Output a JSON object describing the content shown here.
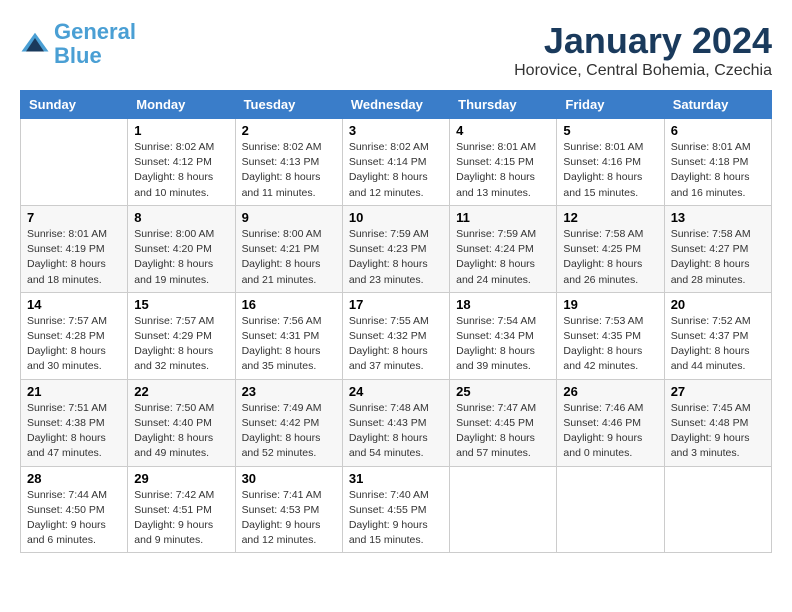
{
  "logo": {
    "line1": "General",
    "line2": "Blue"
  },
  "title": "January 2024",
  "location": "Horovice, Central Bohemia, Czechia",
  "days_of_week": [
    "Sunday",
    "Monday",
    "Tuesday",
    "Wednesday",
    "Thursday",
    "Friday",
    "Saturday"
  ],
  "weeks": [
    [
      {
        "day": "",
        "info": ""
      },
      {
        "day": "1",
        "info": "Sunrise: 8:02 AM\nSunset: 4:12 PM\nDaylight: 8 hours\nand 10 minutes."
      },
      {
        "day": "2",
        "info": "Sunrise: 8:02 AM\nSunset: 4:13 PM\nDaylight: 8 hours\nand 11 minutes."
      },
      {
        "day": "3",
        "info": "Sunrise: 8:02 AM\nSunset: 4:14 PM\nDaylight: 8 hours\nand 12 minutes."
      },
      {
        "day": "4",
        "info": "Sunrise: 8:01 AM\nSunset: 4:15 PM\nDaylight: 8 hours\nand 13 minutes."
      },
      {
        "day": "5",
        "info": "Sunrise: 8:01 AM\nSunset: 4:16 PM\nDaylight: 8 hours\nand 15 minutes."
      },
      {
        "day": "6",
        "info": "Sunrise: 8:01 AM\nSunset: 4:18 PM\nDaylight: 8 hours\nand 16 minutes."
      }
    ],
    [
      {
        "day": "7",
        "info": "Sunrise: 8:01 AM\nSunset: 4:19 PM\nDaylight: 8 hours\nand 18 minutes."
      },
      {
        "day": "8",
        "info": "Sunrise: 8:00 AM\nSunset: 4:20 PM\nDaylight: 8 hours\nand 19 minutes."
      },
      {
        "day": "9",
        "info": "Sunrise: 8:00 AM\nSunset: 4:21 PM\nDaylight: 8 hours\nand 21 minutes."
      },
      {
        "day": "10",
        "info": "Sunrise: 7:59 AM\nSunset: 4:23 PM\nDaylight: 8 hours\nand 23 minutes."
      },
      {
        "day": "11",
        "info": "Sunrise: 7:59 AM\nSunset: 4:24 PM\nDaylight: 8 hours\nand 24 minutes."
      },
      {
        "day": "12",
        "info": "Sunrise: 7:58 AM\nSunset: 4:25 PM\nDaylight: 8 hours\nand 26 minutes."
      },
      {
        "day": "13",
        "info": "Sunrise: 7:58 AM\nSunset: 4:27 PM\nDaylight: 8 hours\nand 28 minutes."
      }
    ],
    [
      {
        "day": "14",
        "info": "Sunrise: 7:57 AM\nSunset: 4:28 PM\nDaylight: 8 hours\nand 30 minutes."
      },
      {
        "day": "15",
        "info": "Sunrise: 7:57 AM\nSunset: 4:29 PM\nDaylight: 8 hours\nand 32 minutes."
      },
      {
        "day": "16",
        "info": "Sunrise: 7:56 AM\nSunset: 4:31 PM\nDaylight: 8 hours\nand 35 minutes."
      },
      {
        "day": "17",
        "info": "Sunrise: 7:55 AM\nSunset: 4:32 PM\nDaylight: 8 hours\nand 37 minutes."
      },
      {
        "day": "18",
        "info": "Sunrise: 7:54 AM\nSunset: 4:34 PM\nDaylight: 8 hours\nand 39 minutes."
      },
      {
        "day": "19",
        "info": "Sunrise: 7:53 AM\nSunset: 4:35 PM\nDaylight: 8 hours\nand 42 minutes."
      },
      {
        "day": "20",
        "info": "Sunrise: 7:52 AM\nSunset: 4:37 PM\nDaylight: 8 hours\nand 44 minutes."
      }
    ],
    [
      {
        "day": "21",
        "info": "Sunrise: 7:51 AM\nSunset: 4:38 PM\nDaylight: 8 hours\nand 47 minutes."
      },
      {
        "day": "22",
        "info": "Sunrise: 7:50 AM\nSunset: 4:40 PM\nDaylight: 8 hours\nand 49 minutes."
      },
      {
        "day": "23",
        "info": "Sunrise: 7:49 AM\nSunset: 4:42 PM\nDaylight: 8 hours\nand 52 minutes."
      },
      {
        "day": "24",
        "info": "Sunrise: 7:48 AM\nSunset: 4:43 PM\nDaylight: 8 hours\nand 54 minutes."
      },
      {
        "day": "25",
        "info": "Sunrise: 7:47 AM\nSunset: 4:45 PM\nDaylight: 8 hours\nand 57 minutes."
      },
      {
        "day": "26",
        "info": "Sunrise: 7:46 AM\nSunset: 4:46 PM\nDaylight: 9 hours\nand 0 minutes."
      },
      {
        "day": "27",
        "info": "Sunrise: 7:45 AM\nSunset: 4:48 PM\nDaylight: 9 hours\nand 3 minutes."
      }
    ],
    [
      {
        "day": "28",
        "info": "Sunrise: 7:44 AM\nSunset: 4:50 PM\nDaylight: 9 hours\nand 6 minutes."
      },
      {
        "day": "29",
        "info": "Sunrise: 7:42 AM\nSunset: 4:51 PM\nDaylight: 9 hours\nand 9 minutes."
      },
      {
        "day": "30",
        "info": "Sunrise: 7:41 AM\nSunset: 4:53 PM\nDaylight: 9 hours\nand 12 minutes."
      },
      {
        "day": "31",
        "info": "Sunrise: 7:40 AM\nSunset: 4:55 PM\nDaylight: 9 hours\nand 15 minutes."
      },
      {
        "day": "",
        "info": ""
      },
      {
        "day": "",
        "info": ""
      },
      {
        "day": "",
        "info": ""
      }
    ]
  ]
}
